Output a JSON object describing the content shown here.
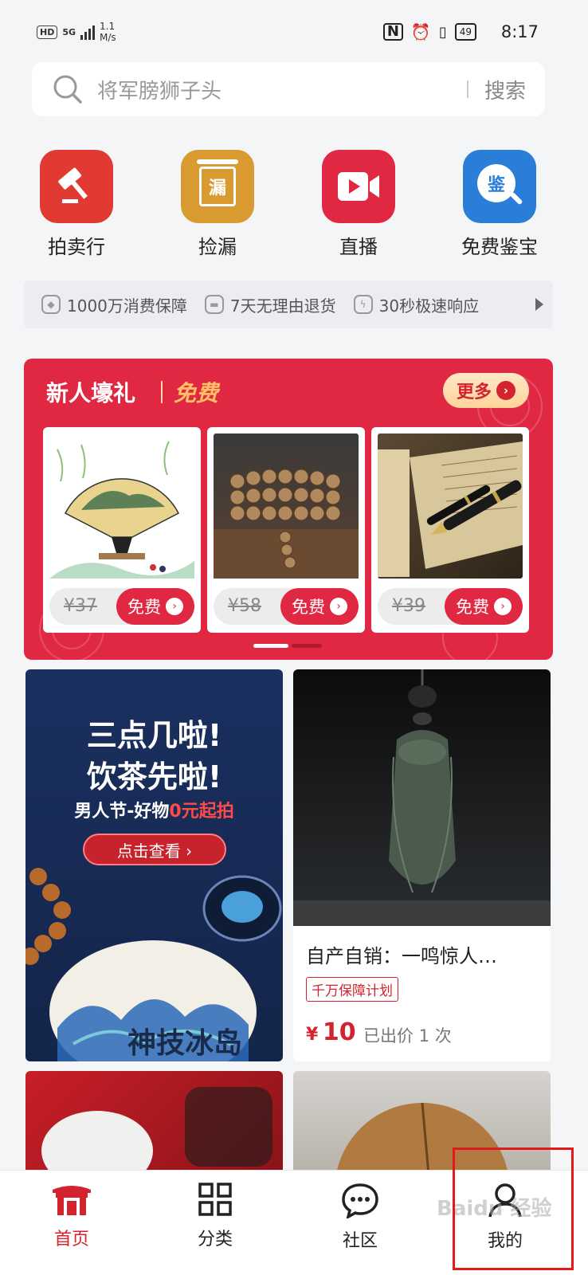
{
  "status_bar": {
    "hd": "HD",
    "net": "5G",
    "speed_value": "1.1",
    "speed_unit": "M/s",
    "battery": "49",
    "time": "8:17"
  },
  "search": {
    "placeholder": "将军膀狮子头",
    "button": "搜索"
  },
  "quick_entries": [
    {
      "label": "拍卖行",
      "icon": "gavel-icon",
      "color": "#e03a32"
    },
    {
      "label": "捡漏",
      "icon": "lou-tag-icon",
      "color": "#d99a30",
      "glyph": "漏"
    },
    {
      "label": "直播",
      "icon": "video-camera-icon",
      "color": "#e02843"
    },
    {
      "label": "免费鉴宝",
      "icon": "appraise-magnifier-icon",
      "color": "#2a7ed8",
      "glyph": "鉴"
    }
  ],
  "guarantees": [
    {
      "label": "1000万消费保障",
      "icon": "shield-icon"
    },
    {
      "label": "7天无理由退货",
      "icon": "truck-icon"
    },
    {
      "label": "30秒极速响应",
      "icon": "lightning-icon"
    }
  ],
  "new_user": {
    "title": "新人壕礼",
    "subtitle": "免费",
    "more": "更多",
    "items": [
      {
        "price": "¥37",
        "action": "免费",
        "image": "folding-fan-painting"
      },
      {
        "price": "¥58",
        "action": "免费",
        "image": "wooden-bead-bracelet"
      },
      {
        "price": "¥39",
        "action": "免费",
        "image": "fountain-pen-scroll"
      }
    ]
  },
  "feed": {
    "banner": {
      "line1": "三点几啦!",
      "line2": "饮茶先啦!",
      "line3_prefix": "男人节-好物",
      "line3_highlight": "0元起拍",
      "button": "点击查看 ›",
      "brush_text": "神技冰岛"
    },
    "product": {
      "name": "自产自销：一鸣惊人…",
      "tag": "千万保障计划",
      "currency": "¥",
      "price": "10",
      "bids": "已出价 1 次"
    }
  },
  "tabbar": [
    {
      "label": "首页",
      "icon": "home-gate-icon",
      "active": true
    },
    {
      "label": "分类",
      "icon": "grid-icon",
      "active": false
    },
    {
      "label": "社区",
      "icon": "chat-bubble-icon",
      "active": false
    },
    {
      "label": "我的",
      "icon": "user-icon",
      "active": false
    }
  ],
  "watermark": "Baidu 经验",
  "colors": {
    "brand_red": "#e02843",
    "gold": "#ffc066",
    "highlight_box": "#e01a1a"
  }
}
